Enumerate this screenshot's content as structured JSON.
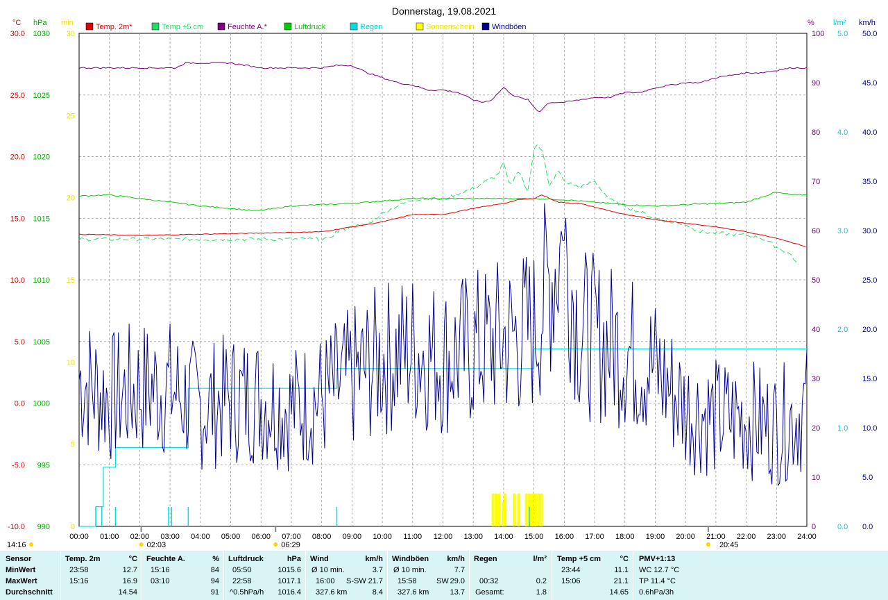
{
  "title": "Donnerstag, 19.08.2021",
  "colors": {
    "temp2m": "#e00000",
    "temp5cm": "#22dd66",
    "feuchte": "#800080",
    "luftdruck": "#00cc00",
    "regen": "#00e0e0",
    "sonne": "#ffff00",
    "wind": "#00008b",
    "panel_bg": "#d8f4f4"
  },
  "axes_labels": {
    "temp_unit": "°C",
    "press_unit": "hPa",
    "min_unit": "min",
    "hum_unit": "%",
    "rain_unit": "l/m²",
    "wind_unit": "km/h"
  },
  "legend": [
    {
      "label": "Temp. 2m*",
      "color": "#e00000"
    },
    {
      "label": "Temp +5 cm",
      "color": "#22dd66"
    },
    {
      "label": "Feuchte A.*",
      "color": "#800080"
    },
    {
      "label": "Luftdruck",
      "color": "#00cc00"
    },
    {
      "label": "Regen",
      "color": "#00e0e0"
    },
    {
      "label": "Sonnenschein",
      "color": "#ffff00"
    },
    {
      "label": "Windböen",
      "color": "#00008b"
    }
  ],
  "chart_data": {
    "type": "line",
    "title": "Donnerstag, 19.08.2021",
    "grid": true,
    "x_range_hours": [
      0,
      24
    ],
    "x_ticks": [
      "00:00",
      "01:00",
      "02:00",
      "03:00",
      "04:00",
      "05:00",
      "06:00",
      "07:00",
      "08:00",
      "09:00",
      "10:00",
      "11:00",
      "12:00",
      "13:00",
      "14:00",
      "15:00",
      "16:00",
      "17:00",
      "18:00",
      "19:00",
      "20:00",
      "21:00",
      "22:00",
      "23:00",
      "24:00"
    ],
    "axes": {
      "temp_c": {
        "range": [
          -10,
          30
        ],
        "ticks": [
          "-10.0",
          "-5.0",
          "0.0",
          "5.0",
          "10.0",
          "15.0",
          "20.0",
          "25.0",
          "30.0"
        ]
      },
      "pressure_hpa": {
        "range": [
          990,
          1030
        ],
        "ticks": [
          "990",
          "995",
          "1000",
          "1005",
          "1010",
          "1015",
          "1020",
          "1025",
          "1030"
        ]
      },
      "sun_min": {
        "range": [
          0,
          30
        ],
        "ticks": [
          "0",
          "5",
          "10",
          "15",
          "20",
          "25",
          "30"
        ]
      },
      "humidity_pct": {
        "range": [
          0,
          100
        ],
        "ticks": [
          "0",
          "10",
          "20",
          "30",
          "40",
          "50",
          "60",
          "70",
          "80",
          "90",
          "100"
        ]
      },
      "rain_lm2": {
        "range": [
          0,
          5
        ],
        "ticks": [
          "0.0",
          "1.0",
          "2.0",
          "3.0",
          "4.0",
          "5.0"
        ]
      },
      "wind_kmh": {
        "range": [
          0,
          50
        ],
        "ticks": [
          "0.0",
          "5.0",
          "10.0",
          "15.0",
          "20.0",
          "25.0",
          "30.0",
          "35.0",
          "40.0",
          "45.0",
          "50.0"
        ]
      }
    },
    "series": [
      {
        "name": "Temp. 2m*",
        "axis": "temp_c",
        "x": [
          0,
          2,
          4,
          6,
          8,
          9,
          10,
          11,
          12,
          13,
          14,
          14.5,
          15,
          15.26,
          15.8,
          16.5,
          17,
          18,
          19,
          20,
          21,
          22,
          23,
          23.97
        ],
        "y": [
          13.7,
          13.6,
          13.7,
          13.8,
          13.9,
          14.3,
          14.7,
          15.3,
          15.3,
          15.8,
          16.2,
          16.5,
          16.6,
          16.9,
          16.3,
          16.2,
          15.9,
          15.3,
          14.9,
          14.6,
          14.3,
          13.9,
          13.4,
          12.7
        ]
      },
      {
        "name": "Temp +5 cm",
        "axis": "temp_c",
        "x": [
          0,
          8.2,
          8.5,
          9,
          9.5,
          10,
          10.5,
          11,
          11.5,
          12,
          12.5,
          13,
          13.5,
          13.8,
          14,
          14.2,
          14.5,
          14.8,
          15,
          15.1,
          15.3,
          15.5,
          15.8,
          16,
          16.5,
          17,
          17.5,
          18,
          18.5,
          19,
          19.5,
          20,
          20.5,
          21,
          22,
          22.5,
          23,
          23.5,
          23.73
        ],
        "y": [
          13.3,
          13.3,
          13.9,
          14.3,
          14.5,
          15.4,
          16.0,
          16.5,
          16.6,
          16.5,
          17.0,
          17.4,
          18.1,
          18.5,
          19.5,
          17.5,
          19.0,
          17.0,
          20.7,
          21.1,
          20.3,
          17.5,
          18.9,
          18.0,
          17.5,
          18.0,
          16.5,
          16.0,
          15.5,
          15.0,
          14.7,
          14.5,
          13.9,
          13.8,
          13.6,
          13.4,
          12.7,
          12.0,
          11.1
        ]
      },
      {
        "name": "Feuchte A.*",
        "axis": "humidity_pct",
        "x": [
          0,
          3.2,
          3.5,
          5,
          5.5,
          6,
          7,
          8,
          8.5,
          9,
          9.5,
          10,
          10.5,
          11,
          11.5,
          12,
          12.5,
          13,
          13.3,
          13.6,
          14,
          14.3,
          14.5,
          14.8,
          15.16,
          15.5,
          16,
          16.5,
          17,
          17.5,
          18,
          18.5,
          19,
          19.5,
          20,
          20.5,
          21,
          22,
          22.5,
          23,
          23.5,
          24
        ],
        "y": [
          93,
          93,
          94,
          94,
          93.5,
          93,
          93,
          93,
          93.5,
          93.5,
          92,
          91,
          90,
          89.5,
          88.5,
          88.5,
          88,
          86.5,
          86,
          86.5,
          89,
          87.5,
          87,
          86.5,
          84,
          86,
          86,
          86.5,
          87,
          87,
          88,
          88,
          89,
          89.5,
          90,
          90,
          91,
          92,
          92,
          92.5,
          93,
          93
        ]
      },
      {
        "name": "Luftdruck",
        "axis": "pressure_hpa",
        "x": [
          0,
          1,
          2,
          3,
          4,
          5,
          5.83,
          6.5,
          7,
          8,
          9,
          10,
          11,
          12,
          13,
          14,
          15,
          16,
          17,
          18,
          19,
          20,
          21,
          22,
          22.97,
          23.5,
          24
        ],
        "y": [
          1016.8,
          1016.9,
          1016.6,
          1016.3,
          1016.0,
          1015.8,
          1015.6,
          1015.8,
          1016.0,
          1016.1,
          1016.2,
          1016.4,
          1016.6,
          1016.6,
          1016.6,
          1016.6,
          1016.6,
          1016.5,
          1016.3,
          1016.1,
          1016.0,
          1016.1,
          1016.2,
          1016.3,
          1017.1,
          1016.9,
          1016.9
        ]
      },
      {
        "name": "Regen",
        "axis": "rain_lm2",
        "x": [
          0,
          0.53,
          0.55,
          0.8,
          1.2,
          2.0,
          3.0,
          3.6,
          4.0,
          5.0,
          6.0,
          8.0,
          8.5,
          10.0,
          13.0,
          14.0,
          15.0,
          15.5,
          16.0,
          18.0,
          20.0,
          22.0,
          24.0
        ],
        "y": [
          0,
          0,
          0.2,
          0.6,
          0.8,
          0.8,
          0.8,
          1.4,
          1.4,
          1.4,
          1.4,
          1.4,
          1.6,
          1.6,
          1.6,
          1.6,
          1.8,
          1.8,
          1.8,
          1.8,
          1.8,
          1.8,
          1.8
        ]
      },
      {
        "name": "Sonnenschein",
        "axis": "sun_min",
        "x": [
          13.65,
          13.75,
          13.85,
          14.0,
          14.05,
          14.35,
          14.5,
          14.75,
          14.85,
          14.95,
          15.05,
          15.15,
          15.25
        ],
        "y": [
          2,
          2,
          2,
          1.5,
          2,
          2,
          2,
          2,
          2,
          2,
          2,
          2,
          2
        ]
      },
      {
        "name": "Windböen",
        "axis": "wind_kmh",
        "x": [
          0,
          1,
          2,
          3,
          4,
          5,
          6,
          7,
          8,
          9,
          10,
          11,
          12,
          13,
          14,
          15,
          15.97,
          16.5,
          17,
          18,
          19,
          20,
          21,
          22,
          23,
          24
        ],
        "y": [
          15,
          13,
          14,
          14,
          12,
          13,
          13,
          12,
          13,
          15,
          17,
          18,
          17,
          18,
          19,
          20,
          29.0,
          20,
          19,
          18,
          16,
          12,
          11,
          11,
          10,
          12
        ]
      }
    ],
    "markers": [
      {
        "label": "02:03",
        "hour": 2.05
      },
      {
        "label": "06:29",
        "hour": 6.48
      },
      {
        "label": "20:45",
        "hour": 20.75
      },
      {
        "label": "14:16",
        "hour": 14.27
      }
    ]
  },
  "stats": {
    "headers": {
      "sensor": "Sensor",
      "temp": "Temp. 2m",
      "temp_unit": "°C",
      "hum": "Feuchte A.",
      "hum_unit": "%",
      "press": "Luftdruck",
      "press_unit": "hPa",
      "wind": "Wind",
      "wind_unit": "km/h",
      "gust": "Windböen",
      "gust_unit": "km/h",
      "rain": "Regen",
      "rain_unit": "l/m²",
      "t5": "Temp +5 cm",
      "t5_unit": "°C",
      "pmv": "PMV+1:13"
    },
    "rows": {
      "min": {
        "label": "MinWert",
        "temp_t": "23:58",
        "temp_v": "12.7",
        "hum_t": "15:16",
        "hum_v": "84",
        "press_t": "05:50",
        "press_v": "1015.6",
        "wind_t": "Ø 10 min.",
        "wind_v": "3.7",
        "gust_t": "Ø 10 min.",
        "gust_v": "7.7",
        "t5_t": "23:44",
        "t5_v": "11.1",
        "pmv": "WC 12.7 °C"
      },
      "max": {
        "label": "MaxWert",
        "temp_t": "15:16",
        "temp_v": "16.9",
        "hum_t": "03:10",
        "hum_v": "94",
        "press_t": "22:58",
        "press_v": "1017.1",
        "wind_t": "16:00",
        "wind_dir": "S-SW",
        "wind_v": "21.7",
        "gust_t": "15:58",
        "gust_dir": "SW",
        "gust_v": "29.0",
        "rain_t": "00:32",
        "rain_v": "0.2",
        "t5_t": "15:06",
        "t5_v": "21.1",
        "pmv": "TP 11.4 °C"
      },
      "avg": {
        "label": "Durchschnitt",
        "temp_v": "14.54",
        "hum_v": "91",
        "press_t": "^0.5hPa/h",
        "press_v": "1016.4",
        "wind_t": "327.6 km",
        "wind_v": "8.4",
        "gust_t": "327.6 km",
        "gust_v": "13.7",
        "rain_t": "Gesamt:",
        "rain_v": "1.8",
        "t5_v": "14.65",
        "pmv": "0.6hPa/3h"
      }
    }
  }
}
